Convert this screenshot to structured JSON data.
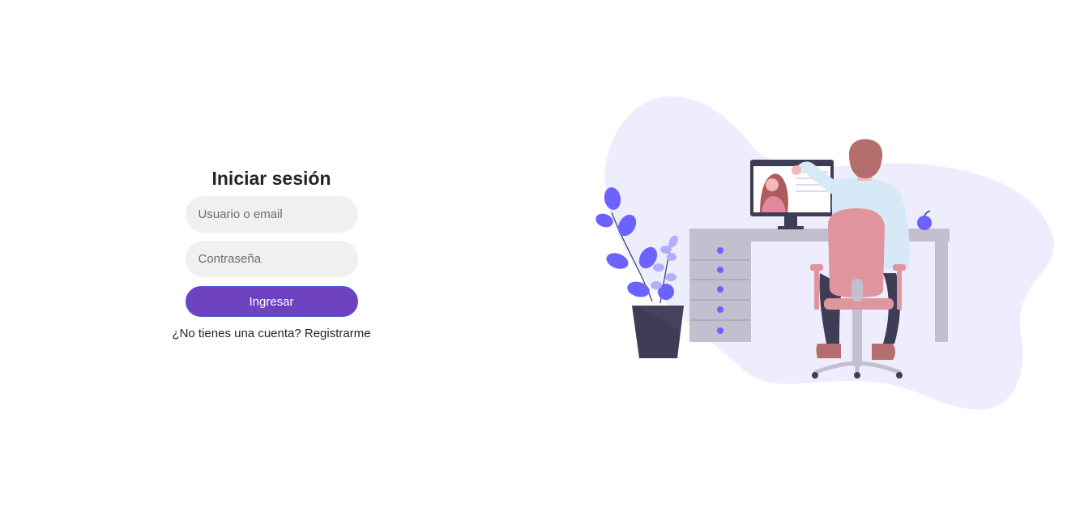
{
  "login": {
    "title": "Iniciar sesión",
    "username_placeholder": "Usuario o email",
    "password_placeholder": "Contraseña",
    "submit_label": "Ingresar",
    "register_prompt": "¿No tienes una cuenta?",
    "register_link": "Registrarme"
  },
  "colors": {
    "accent": "#6f42c1",
    "input_bg": "#f0f0f0",
    "blob": "#eeedfd",
    "plant": "#6c63ff"
  },
  "illustration": {
    "name": "remote-work-illustration"
  }
}
